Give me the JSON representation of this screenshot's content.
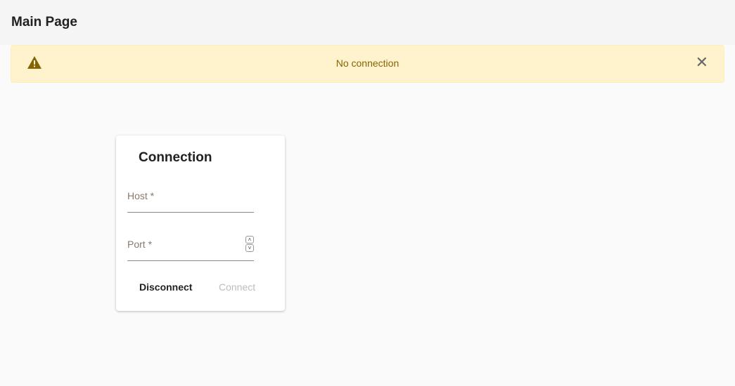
{
  "header": {
    "title": "Main Page"
  },
  "alert": {
    "message": "No connection",
    "close": "✕"
  },
  "card": {
    "title": "Connection",
    "host_label": "Host *",
    "port_label": "Port *",
    "disconnect": "Disconnect",
    "connect": "Connect"
  },
  "colors": {
    "alert_bg": "#fff3cd",
    "alert_text": "#856404"
  }
}
